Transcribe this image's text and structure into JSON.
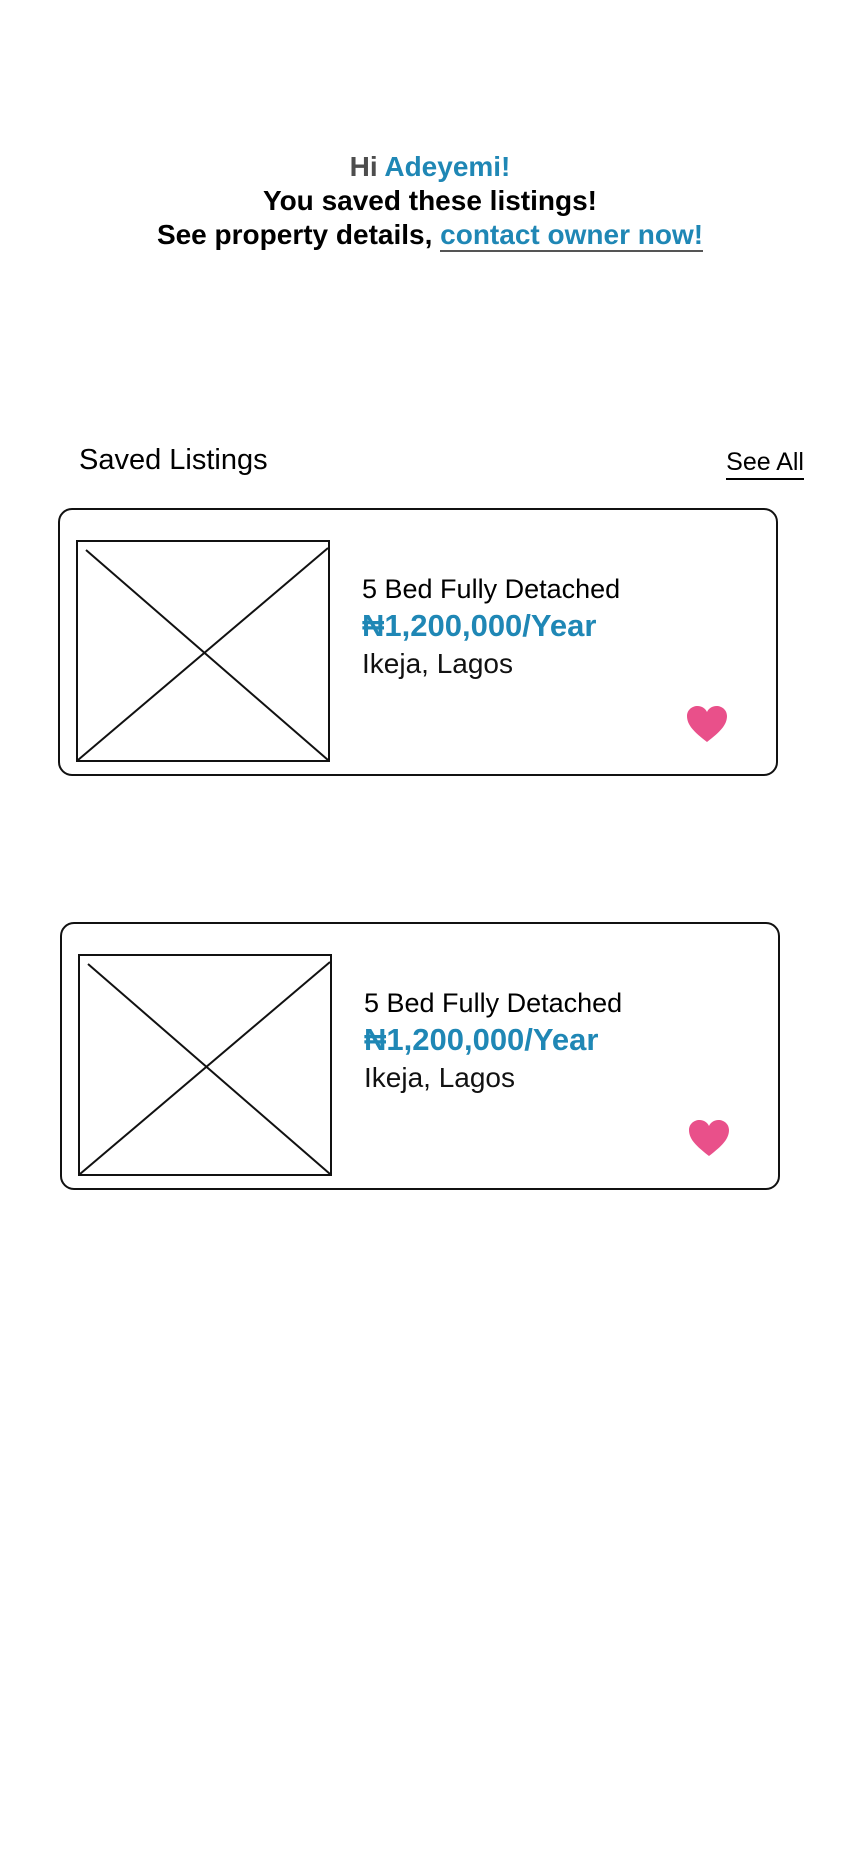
{
  "header": {
    "hi": "Hi",
    "name": "Adeyemi!",
    "line2": "You saved these listings!",
    "line3_prefix": "See property details,",
    "cta_link": "contact owner now!"
  },
  "section": {
    "title": "Saved Listings",
    "see_all": "See All"
  },
  "listings": [
    {
      "title": "5 Bed Fully Detached",
      "price": "₦1,200,000/Year",
      "location": "Ikeja, Lagos",
      "saved": true
    },
    {
      "title": "5 Bed Fully Detached",
      "price": "₦1,200,000/Year",
      "location": "Ikeja, Lagos",
      "saved": true
    }
  ],
  "icons": {
    "favorite": "heart-icon",
    "placeholder": "image-placeholder-icon"
  },
  "colors": {
    "accent": "#1f87b5",
    "heart": "#e9508a",
    "border": "#111111"
  }
}
